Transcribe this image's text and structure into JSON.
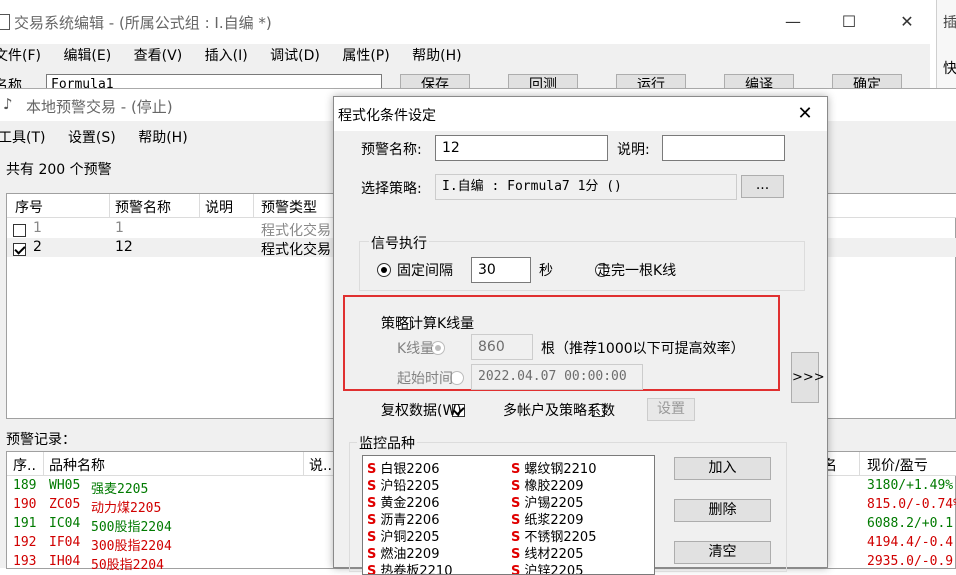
{
  "editor_window": {
    "title": "交易系统编辑 - (所属公式组 : I.自编 *)",
    "menu": [
      "文件(F)",
      "编辑(E)",
      "查看(V)",
      "插入(I)",
      "调试(D)",
      "属性(P)",
      "帮助(H)"
    ],
    "name_label": "名称",
    "name_value": "Formula1",
    "buttons": [
      "保存",
      "回测",
      "运行",
      "编译",
      "确定"
    ]
  },
  "right_edge": {
    "line1": "插",
    "line2": "快"
  },
  "alert_window": {
    "title": "本地预警交易 - (停止)",
    "menu": [
      "工具(T)",
      "设置(S)",
      "帮助(H)"
    ],
    "count_text": "共有 200 个预警",
    "columns": [
      "序号",
      "预警名称",
      "说明",
      "预警类型"
    ],
    "rows": [
      {
        "id": "1",
        "name": "1",
        "type": "程式化交易",
        "checked": false
      },
      {
        "id": "2",
        "name": "12",
        "type": "程式化交易",
        "checked": true
      }
    ],
    "records_label": "预警记录：",
    "records_columns": [
      "序..",
      "品种名称",
      "说..",
      "名",
      "现价/盈亏"
    ],
    "records": [
      {
        "id": "189",
        "code": "WH05",
        "name": "强麦2205",
        "price": "3180/+1.49%",
        "color": "#007a00"
      },
      {
        "id": "190",
        "code": "ZC05",
        "name": "动力煤2205",
        "price": "815.0/-0.74%",
        "color": "#d00000"
      },
      {
        "id": "191",
        "code": "IC04",
        "name": "500股指2204",
        "price": "6088.2/+0.1",
        "color": "#007a00"
      },
      {
        "id": "192",
        "code": "IF04",
        "name": "300股指2204",
        "price": "4194.4/-0.4",
        "color": "#d00000"
      },
      {
        "id": "193",
        "code": "IH04",
        "name": "50股指2204",
        "price": "2935.0/-0.9",
        "color": "#d00000"
      }
    ]
  },
  "dialog": {
    "title": "程式化条件设定",
    "alert_name_label": "预警名称:",
    "alert_name_value": "12",
    "desc_label": "说明:",
    "desc_value": "",
    "strategy_label": "选择策略:",
    "strategy_value": "I.自编 : Formula7 1分 ()",
    "browse_label": "...",
    "signal_group": "信号执行",
    "fixed_interval_label": "固定间隔",
    "interval_value": "30",
    "seconds_label": "秒",
    "finish_bar_label": "走完一根K线",
    "calc_bars_label": "策略计算K线量",
    "bar_count_label": "K线量",
    "bar_count_value": "860",
    "bar_hint": "根（推荐1000以下可提高效率）",
    "start_time_label": "起始时间",
    "start_time_value": "2022.04.07 00:00:00",
    "expand_label": ">>>",
    "rights_label": "复权数据(W)",
    "multi_account_label": "多帐户及策略系数",
    "settings_label": "设置",
    "monitor_group": "监控品种",
    "monitor_left": [
      "白银2206",
      "沪铅2205",
      "黄金2206",
      "沥青2206",
      "沪铜2205",
      "燃油2209",
      "热卷板2210"
    ],
    "monitor_right": [
      "螺纹钢2210",
      "橡胶2209",
      "沪锡2205",
      "纸浆2209",
      "不锈钢2205",
      "线材2205",
      "沪锌2205"
    ],
    "add_label": "加入",
    "delete_label": "删除",
    "clear_label": "清空",
    "highlight_color": "#e03030"
  }
}
